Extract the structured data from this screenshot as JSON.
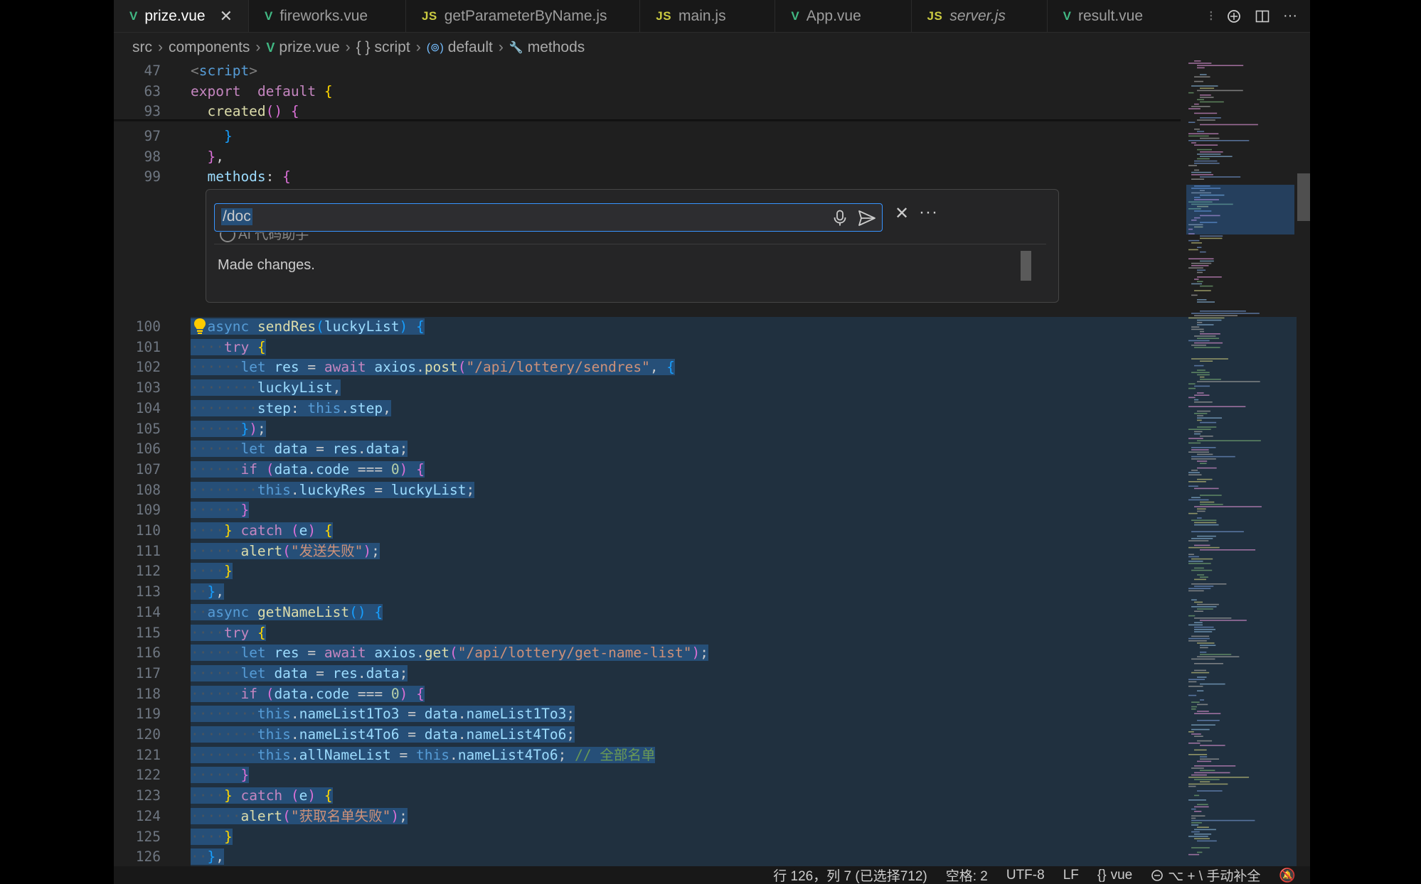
{
  "tabs": [
    {
      "label": "prize.vue",
      "type": "vue",
      "active": true
    },
    {
      "label": "fireworks.vue",
      "type": "vue"
    },
    {
      "label": "getParameterByName.js",
      "type": "js"
    },
    {
      "label": "main.js",
      "type": "js"
    },
    {
      "label": "App.vue",
      "type": "vue"
    },
    {
      "label": "server.js",
      "type": "js",
      "italic": true
    },
    {
      "label": "result.vue",
      "type": "vue"
    }
  ],
  "breadcrumb": {
    "items": [
      "src",
      "components",
      "prize.vue",
      "script",
      "default",
      "methods"
    ]
  },
  "icons": {
    "vue": "V",
    "js": "JS",
    "braces": "{ }",
    "module": "(⊚)",
    "wrench": "🔧"
  },
  "sticky_lines": [
    {
      "n": "47",
      "tokens": [
        [
          "tag",
          "<"
        ],
        [
          "tagn",
          "script"
        ],
        [
          "tag",
          ">"
        ]
      ]
    },
    {
      "n": "63",
      "tokens": [
        [
          "ctl",
          "export"
        ],
        [
          "",
          "  "
        ],
        [
          "ctl",
          "default"
        ],
        [
          "",
          " "
        ],
        [
          "br1",
          "{"
        ]
      ]
    },
    {
      "n": "93",
      "tokens": [
        [
          "",
          "  "
        ],
        [
          "fn",
          "created"
        ],
        [
          "br2",
          "()"
        ],
        [
          "",
          " "
        ],
        [
          "br2",
          "{"
        ]
      ]
    }
  ],
  "pre_lines": [
    {
      "n": "97",
      "tokens": [
        [
          "",
          "    "
        ],
        [
          "br3",
          "}"
        ]
      ]
    },
    {
      "n": "98",
      "tokens": [
        [
          "",
          "  "
        ],
        [
          "br2",
          "}"
        ],
        [
          "",
          ","
        ]
      ]
    },
    {
      "n": "99",
      "tokens": [
        [
          "",
          "  "
        ],
        [
          "var",
          "methods"
        ],
        [
          "",
          ": "
        ],
        [
          "br2",
          "{"
        ]
      ]
    }
  ],
  "chat": {
    "input_value": "/doc",
    "header_text": "AI 代码助手",
    "message": "Made changes."
  },
  "code_lines": [
    {
      "n": "100",
      "tokens": [
        [
          "dot",
          "··"
        ],
        [
          "kw",
          "async"
        ],
        [
          "",
          " "
        ],
        [
          "fn",
          "sendRes"
        ],
        [
          "br3",
          "("
        ],
        [
          "var",
          "luckyList"
        ],
        [
          "br3",
          ")"
        ],
        [
          "",
          " "
        ],
        [
          "br3",
          "{"
        ]
      ]
    },
    {
      "n": "101",
      "tokens": [
        [
          "dot",
          "····"
        ],
        [
          "ctl",
          "try"
        ],
        [
          "",
          " "
        ],
        [
          "br1",
          "{"
        ]
      ]
    },
    {
      "n": "102",
      "tokens": [
        [
          "dot",
          "······"
        ],
        [
          "kw",
          "let"
        ],
        [
          "",
          " "
        ],
        [
          "var",
          "res"
        ],
        [
          "",
          " = "
        ],
        [
          "ctl",
          "await"
        ],
        [
          "",
          " "
        ],
        [
          "var",
          "axios"
        ],
        [
          "",
          "."
        ],
        [
          "fn",
          "post"
        ],
        [
          "br2",
          "("
        ],
        [
          "str",
          "\"/api/lottery/sendres\""
        ],
        [
          "",
          ", "
        ],
        [
          "br3",
          "{"
        ]
      ]
    },
    {
      "n": "103",
      "tokens": [
        [
          "dot",
          "········"
        ],
        [
          "var",
          "luckyList"
        ],
        [
          "",
          ","
        ]
      ]
    },
    {
      "n": "104",
      "tokens": [
        [
          "dot",
          "········"
        ],
        [
          "var",
          "step"
        ],
        [
          "",
          ": "
        ],
        [
          "kw",
          "this"
        ],
        [
          "",
          "."
        ],
        [
          "var",
          "step"
        ],
        [
          "",
          ","
        ]
      ]
    },
    {
      "n": "105",
      "tokens": [
        [
          "dot",
          "······"
        ],
        [
          "br3",
          "}"
        ],
        [
          "br2",
          ")"
        ],
        [
          "",
          ";"
        ]
      ]
    },
    {
      "n": "106",
      "tokens": [
        [
          "dot",
          "······"
        ],
        [
          "kw",
          "let"
        ],
        [
          "",
          " "
        ],
        [
          "var",
          "data"
        ],
        [
          "",
          " = "
        ],
        [
          "var",
          "res"
        ],
        [
          "",
          "."
        ],
        [
          "var",
          "data"
        ],
        [
          "",
          ";"
        ]
      ]
    },
    {
      "n": "107",
      "tokens": [
        [
          "dot",
          "······"
        ],
        [
          "ctl",
          "if"
        ],
        [
          "",
          " "
        ],
        [
          "br2",
          "("
        ],
        [
          "var",
          "data"
        ],
        [
          "",
          "."
        ],
        [
          "var",
          "code"
        ],
        [
          "",
          " === "
        ],
        [
          "num",
          "0"
        ],
        [
          "br2",
          ")"
        ],
        [
          "",
          " "
        ],
        [
          "br2",
          "{"
        ]
      ]
    },
    {
      "n": "108",
      "tokens": [
        [
          "dot",
          "········"
        ],
        [
          "kw",
          "this"
        ],
        [
          "",
          "."
        ],
        [
          "var",
          "luckyRes"
        ],
        [
          "",
          " = "
        ],
        [
          "var",
          "luckyList"
        ],
        [
          "",
          ";"
        ]
      ]
    },
    {
      "n": "109",
      "tokens": [
        [
          "dot",
          "······"
        ],
        [
          "br2",
          "}"
        ]
      ]
    },
    {
      "n": "110",
      "tokens": [
        [
          "dot",
          "····"
        ],
        [
          "br1",
          "}"
        ],
        [
          "",
          " "
        ],
        [
          "ctl",
          "catch"
        ],
        [
          "",
          " "
        ],
        [
          "br2",
          "("
        ],
        [
          "var",
          "e"
        ],
        [
          "br2",
          ")"
        ],
        [
          "",
          " "
        ],
        [
          "br1",
          "{"
        ]
      ]
    },
    {
      "n": "111",
      "tokens": [
        [
          "dot",
          "······"
        ],
        [
          "fn",
          "alert"
        ],
        [
          "br2",
          "("
        ],
        [
          "str",
          "\"发送失败\""
        ],
        [
          "br2",
          ")"
        ],
        [
          "",
          ";"
        ]
      ]
    },
    {
      "n": "112",
      "tokens": [
        [
          "dot",
          "····"
        ],
        [
          "br1",
          "}"
        ]
      ]
    },
    {
      "n": "113",
      "tokens": [
        [
          "dot",
          "··"
        ],
        [
          "br3",
          "}"
        ],
        [
          "",
          ","
        ]
      ]
    },
    {
      "n": "114",
      "tokens": [
        [
          "dot",
          "··"
        ],
        [
          "kw",
          "async"
        ],
        [
          "",
          " "
        ],
        [
          "fn",
          "getNameList"
        ],
        [
          "br3",
          "()"
        ],
        [
          "",
          " "
        ],
        [
          "br3",
          "{"
        ]
      ]
    },
    {
      "n": "115",
      "tokens": [
        [
          "dot",
          "····"
        ],
        [
          "ctl",
          "try"
        ],
        [
          "",
          " "
        ],
        [
          "br1",
          "{"
        ]
      ]
    },
    {
      "n": "116",
      "tokens": [
        [
          "dot",
          "······"
        ],
        [
          "kw",
          "let"
        ],
        [
          "",
          " "
        ],
        [
          "var",
          "res"
        ],
        [
          "",
          " = "
        ],
        [
          "ctl",
          "await"
        ],
        [
          "",
          " "
        ],
        [
          "var",
          "axios"
        ],
        [
          "",
          "."
        ],
        [
          "fn",
          "get"
        ],
        [
          "br2",
          "("
        ],
        [
          "str",
          "\"/api/lottery/get-name-list\""
        ],
        [
          "br2",
          ")"
        ],
        [
          "",
          ";"
        ]
      ]
    },
    {
      "n": "117",
      "tokens": [
        [
          "dot",
          "······"
        ],
        [
          "kw",
          "let"
        ],
        [
          "",
          " "
        ],
        [
          "var",
          "data"
        ],
        [
          "",
          " = "
        ],
        [
          "var",
          "res"
        ],
        [
          "",
          "."
        ],
        [
          "var",
          "data"
        ],
        [
          "",
          ";"
        ]
      ]
    },
    {
      "n": "118",
      "tokens": [
        [
          "dot",
          "······"
        ],
        [
          "ctl",
          "if"
        ],
        [
          "",
          " "
        ],
        [
          "br2",
          "("
        ],
        [
          "var",
          "data"
        ],
        [
          "",
          "."
        ],
        [
          "var",
          "code"
        ],
        [
          "",
          " === "
        ],
        [
          "num",
          "0"
        ],
        [
          "br2",
          ")"
        ],
        [
          "",
          " "
        ],
        [
          "br2",
          "{"
        ]
      ]
    },
    {
      "n": "119",
      "tokens": [
        [
          "dot",
          "········"
        ],
        [
          "kw",
          "this"
        ],
        [
          "",
          "."
        ],
        [
          "var",
          "nameList1To3"
        ],
        [
          "",
          " = "
        ],
        [
          "var",
          "data"
        ],
        [
          "",
          "."
        ],
        [
          "var",
          "nameList1To3"
        ],
        [
          "",
          ";"
        ]
      ]
    },
    {
      "n": "120",
      "tokens": [
        [
          "dot",
          "········"
        ],
        [
          "kw",
          "this"
        ],
        [
          "",
          "."
        ],
        [
          "var",
          "nameList4To6"
        ],
        [
          "",
          " = "
        ],
        [
          "var",
          "data"
        ],
        [
          "",
          "."
        ],
        [
          "var",
          "nameList4To6"
        ],
        [
          "",
          ";"
        ]
      ]
    },
    {
      "n": "121",
      "tokens": [
        [
          "dot",
          "········"
        ],
        [
          "kw",
          "this"
        ],
        [
          "",
          "."
        ],
        [
          "var",
          "allNameList"
        ],
        [
          "",
          " = "
        ],
        [
          "kw",
          "this"
        ],
        [
          "",
          "."
        ],
        [
          "var",
          "nameList4To6"
        ],
        [
          "",
          "; "
        ],
        [
          "cm",
          "// 全部名单"
        ]
      ]
    },
    {
      "n": "122",
      "tokens": [
        [
          "dot",
          "······"
        ],
        [
          "br2",
          "}"
        ]
      ]
    },
    {
      "n": "123",
      "tokens": [
        [
          "dot",
          "····"
        ],
        [
          "br1",
          "}"
        ],
        [
          "",
          " "
        ],
        [
          "ctl",
          "catch"
        ],
        [
          "",
          " "
        ],
        [
          "br2",
          "("
        ],
        [
          "var",
          "e"
        ],
        [
          "br2",
          ")"
        ],
        [
          "",
          " "
        ],
        [
          "br1",
          "{"
        ]
      ]
    },
    {
      "n": "124",
      "tokens": [
        [
          "dot",
          "······"
        ],
        [
          "fn",
          "alert"
        ],
        [
          "br2",
          "("
        ],
        [
          "str",
          "\"获取名单失败\""
        ],
        [
          "br2",
          ")"
        ],
        [
          "",
          ";"
        ]
      ]
    },
    {
      "n": "125",
      "tokens": [
        [
          "dot",
          "····"
        ],
        [
          "br1",
          "}"
        ]
      ]
    },
    {
      "n": "126",
      "tokens": [
        [
          "dot",
          "··"
        ],
        [
          "br3",
          "}"
        ],
        [
          "",
          ","
        ]
      ]
    }
  ],
  "status": {
    "position": "行 126，列 7 (已选择712)",
    "indent": "空格: 2",
    "encoding": "UTF-8",
    "eol": "LF",
    "language": "vue",
    "copilot": "⌥ + \\ 手动补全"
  }
}
